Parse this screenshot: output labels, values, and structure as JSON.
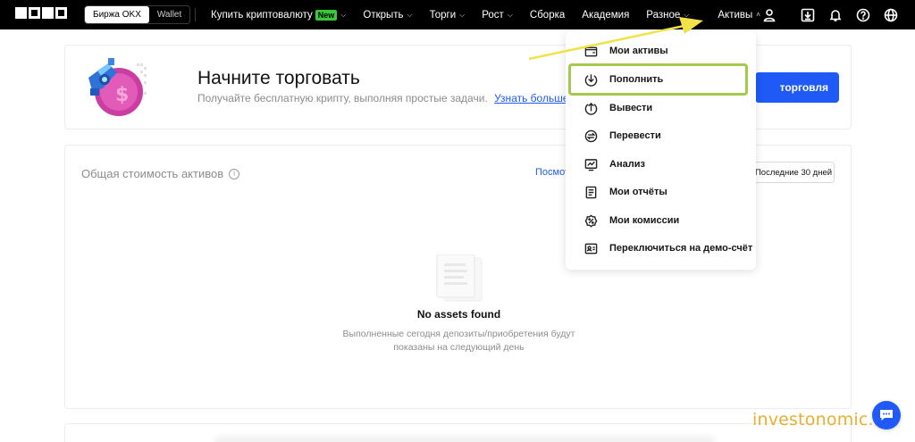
{
  "topbar": {
    "env_tabs": [
      {
        "label": "Биржа OKX",
        "active": true
      },
      {
        "label": "Wallet",
        "active": false
      }
    ],
    "nav_items": [
      {
        "label": "Купить криптовалюту",
        "badge": "New",
        "has_chevron": true
      },
      {
        "label": "Открыть",
        "has_chevron": true
      },
      {
        "label": "Торги",
        "has_chevron": true
      },
      {
        "label": "Рост",
        "has_chevron": true
      },
      {
        "label": "Сборка",
        "has_chevron": false
      },
      {
        "label": "Академия",
        "has_chevron": false
      },
      {
        "label": "Разное",
        "has_chevron": true
      },
      {
        "label": "Активы",
        "has_chevron": true,
        "open": true
      }
    ],
    "icons": [
      "user-icon",
      "download-icon",
      "bell-icon",
      "help-icon",
      "globe-icon"
    ]
  },
  "hero": {
    "title": "Начните торговать",
    "subtitle": "Получайте бесплатную крипту, выполняя простые задачи.",
    "link": "Узнать больше.",
    "cta_label": "торговля"
  },
  "assets_card": {
    "title": "Общая стоимость активов",
    "view_link": "Посмот",
    "period_button": "Последние 30 дней",
    "empty_title": "No assets found",
    "empty_desc": "Выполненные сегодня депозиты/приобретения будут показаны на следующий день"
  },
  "dropdown": {
    "items": [
      {
        "label": "Мои активы",
        "icon": "wallet-icon"
      },
      {
        "label": "Пополнить",
        "icon": "deposit-icon",
        "highlighted": true
      },
      {
        "label": "Вывести",
        "icon": "withdraw-icon"
      },
      {
        "label": "Перевести",
        "icon": "transfer-icon"
      },
      {
        "label": "Анализ",
        "icon": "analysis-icon"
      },
      {
        "label": "Мои отчёты",
        "icon": "reports-icon"
      },
      {
        "label": "Мои комиссии",
        "icon": "fees-icon"
      },
      {
        "label": "Переключиться на демо-счёт",
        "icon": "demo-account-icon"
      }
    ]
  },
  "watermark": "investonomic.ru",
  "colors": {
    "accent": "#1f5af6",
    "highlight": "#a5c94a",
    "arrow": "#f2e24a",
    "badge": "#37c936",
    "watermark": "#e8b030"
  }
}
